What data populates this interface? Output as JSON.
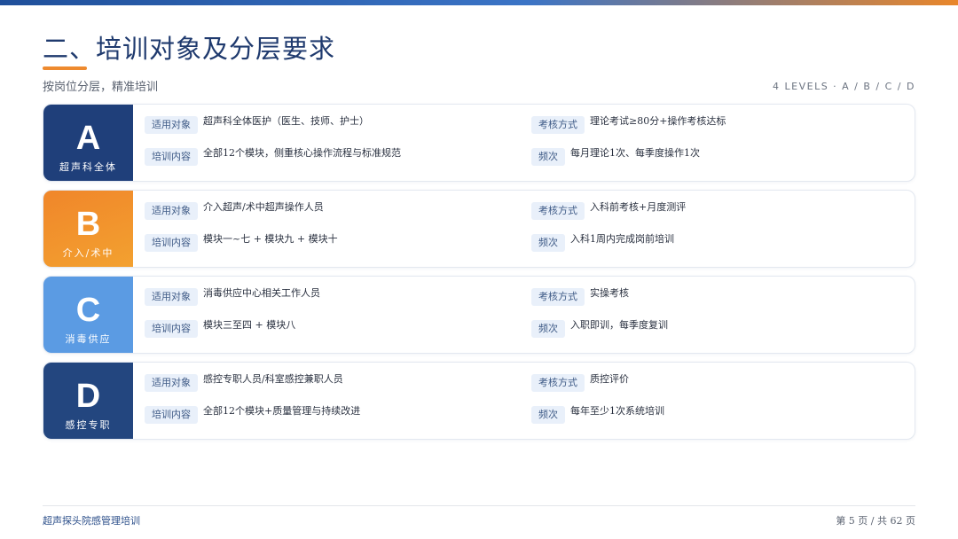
{
  "header": {
    "title": "二、培训对象及分层要求",
    "subtitle": "按岗位分层，精准培训",
    "levels_caption": "4 LEVELS · A / B / C / D"
  },
  "field_labels": {
    "target": "适用对象",
    "content": "培训内容",
    "assessment": "考核方式",
    "frequency": "频次"
  },
  "levels": [
    {
      "letter": "A",
      "name": "超声科全体",
      "target": "超声科全体医护（医生、技师、护士）",
      "content": "全部12个模块，侧重核心操作流程与标准规范",
      "assessment": "理论考试≥80分+操作考核达标",
      "frequency": "每月理论1次、每季度操作1次"
    },
    {
      "letter": "B",
      "name": "介入/术中",
      "target": "介入超声/术中超声操作人员",
      "content": "模块一~七 + 模块九 + 模块十",
      "assessment": "入科前考核+月度测评",
      "frequency": "入科1周内完成岗前培训"
    },
    {
      "letter": "C",
      "name": "消毒供应",
      "target": "消毒供应中心相关工作人员",
      "content": "模块三至四 + 模块八",
      "assessment": "实操考核",
      "frequency": "入职即训，每季度复训"
    },
    {
      "letter": "D",
      "name": "感控专职",
      "target": "感控专职人员/科室感控兼职人员",
      "content": "全部12个模块+质量管理与持续改进",
      "assessment": "质控评价",
      "frequency": "每年至少1次系统培训"
    }
  ],
  "footer": {
    "left": "超声探头院感管理培训",
    "page": "第 5 页 / 共 62 页"
  },
  "colors": {
    "level_a": "#1f3f7a",
    "level_b": "#f0862a",
    "level_c": "#5b9be3",
    "level_d": "#23467f",
    "accent_orange": "#ee8a2f"
  }
}
